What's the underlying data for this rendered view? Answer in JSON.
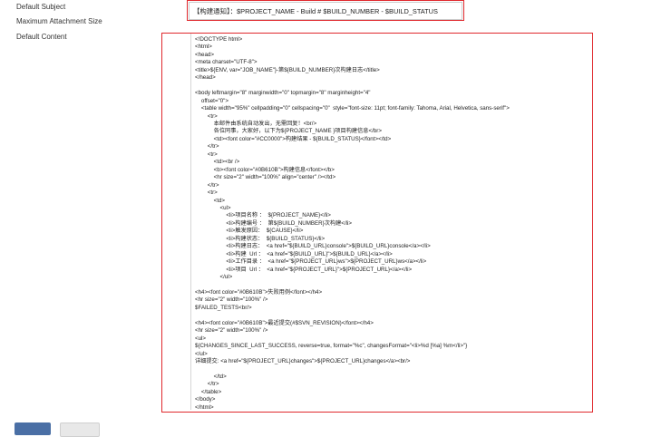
{
  "labels": {
    "default_subject": "Default Subject",
    "max_attachment": "Maximum Attachment Size",
    "default_content": "Default Content"
  },
  "subject": {
    "value": "【构建通知】：$PROJECT_NAME - Build # $BUILD_NUMBER - $BUILD_STATUS"
  },
  "content": {
    "value": "<!DOCTYPE html>\n<html>\n<head>\n<meta charset=\"UTF-8\">\n<title>${ENV, var=\"JOB_NAME\"}-第${BUILD_NUMBER}次构建日志</title>\n</head>\n\n<body leftmargin=\"8\" marginwidth=\"0\" topmargin=\"8\" marginheight=\"4\"\n    offset=\"0\">\n    <table width=\"95%\" cellpadding=\"0\" cellspacing=\"0\"  style=\"font-size: 11pt; font-family: Tahoma, Arial, Helvetica, sans-serif\">\n        <tr>\n            本邮件由系统自动发出，无需回复！<br/>\n            各位同事，大家好，以下为${PROJECT_NAME }项目构建信息</br>\n            <td><font color=\"#CC0000\">构建结果 - ${BUILD_STATUS}</font></td>\n        </tr>\n        <tr>\n            <td><br />\n            <b><font color=\"#0B610B\">构建信息</font></b>\n            <hr size=\"2\" width=\"100%\" align=\"center\" /></td>\n        </tr>\n        <tr>\n            <td>\n                <ul>\n                    <li>项目名称 ：  ${PROJECT_NAME}</li>\n                    <li>构建编号 ：  第${BUILD_NUMBER}次构建</li>\n                    <li>触发原因：  ${CAUSE}</li>\n                    <li>构建状态：  ${BUILD_STATUS}</li>\n                    <li>构建日志：  <a href=\"${BUILD_URL}console\">${BUILD_URL}console</a></li>\n                    <li>构建  Url ：  <a href=\"${BUILD_URL}\">${BUILD_URL}</a></li>\n                    <li>工作目录 ：  <a href=\"${PROJECT_URL}ws\">${PROJECT_URL}ws</a></li>\n                    <li>项目  Url ：  <a href=\"${PROJECT_URL}\">${PROJECT_URL}</a></li>\n                </ul>\n\n<h4><font color=\"#0B610B\">失败用例</font></h4>\n<hr size=\"2\" width=\"100%\" />\n$FAILED_TESTS<br/>\n\n<h4><font color=\"#0B610B\">最近提交(#$SVN_REVISION)</font></h4>\n<hr size=\"2\" width=\"100%\" />\n<ul>\n${CHANGES_SINCE_LAST_SUCCESS, reverse=true, format=\"%c\", changesFormat=\"<li>%d [%a] %m</li>\"}\n</ul>\n详细提交: <a href=\"${PROJECT_URL}changes\">${PROJECT_URL}changes</a><br/>\n\n            </td>\n        </tr>\n    </table>\n</body>\n</html>"
  },
  "buttons": {
    "primary": "",
    "secondary": ""
  },
  "colors": {
    "highlight": "#e0282d",
    "primary_button": "#4a6fa5"
  }
}
